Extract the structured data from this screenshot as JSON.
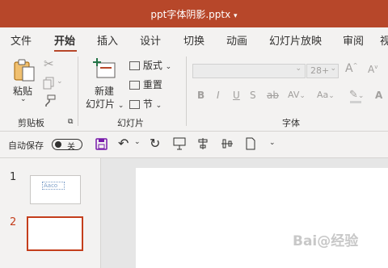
{
  "titlebar": {
    "filename": "ppt字体阴影.pptx",
    "dropdown_glyph": "▾"
  },
  "tabs": [
    {
      "label": "文件"
    },
    {
      "label": "开始",
      "active": true
    },
    {
      "label": "插入"
    },
    {
      "label": "设计"
    },
    {
      "label": "切换"
    },
    {
      "label": "动画"
    },
    {
      "label": "幻灯片放映"
    },
    {
      "label": "审阅"
    },
    {
      "label": "视"
    }
  ],
  "ribbon": {
    "clipboard": {
      "paste_label": "粘贴",
      "group_label": "剪贴板"
    },
    "slides": {
      "new_slide_line1": "新建",
      "new_slide_line2": "幻灯片",
      "layout_label": "版式",
      "reset_label": "重置",
      "section_label": "节",
      "group_label": "幻灯片"
    },
    "font": {
      "font_size": "28+",
      "group_label": "字体",
      "bold": "B",
      "italic": "I",
      "underline": "U",
      "strike": "S",
      "strike2": "ab",
      "spacing": "AV",
      "change_case": "Aa",
      "grow": "A",
      "shrink": "A"
    }
  },
  "quick_access": {
    "autosave_label": "自动保存",
    "autosave_state": "关"
  },
  "thumbnails": [
    {
      "number": "1",
      "text": "Aaco"
    },
    {
      "number": "2",
      "text": ""
    }
  ],
  "watermark": "Bai@经验",
  "colors": {
    "accent": "#b7472a",
    "selected_thumb": "#c43e1c"
  }
}
